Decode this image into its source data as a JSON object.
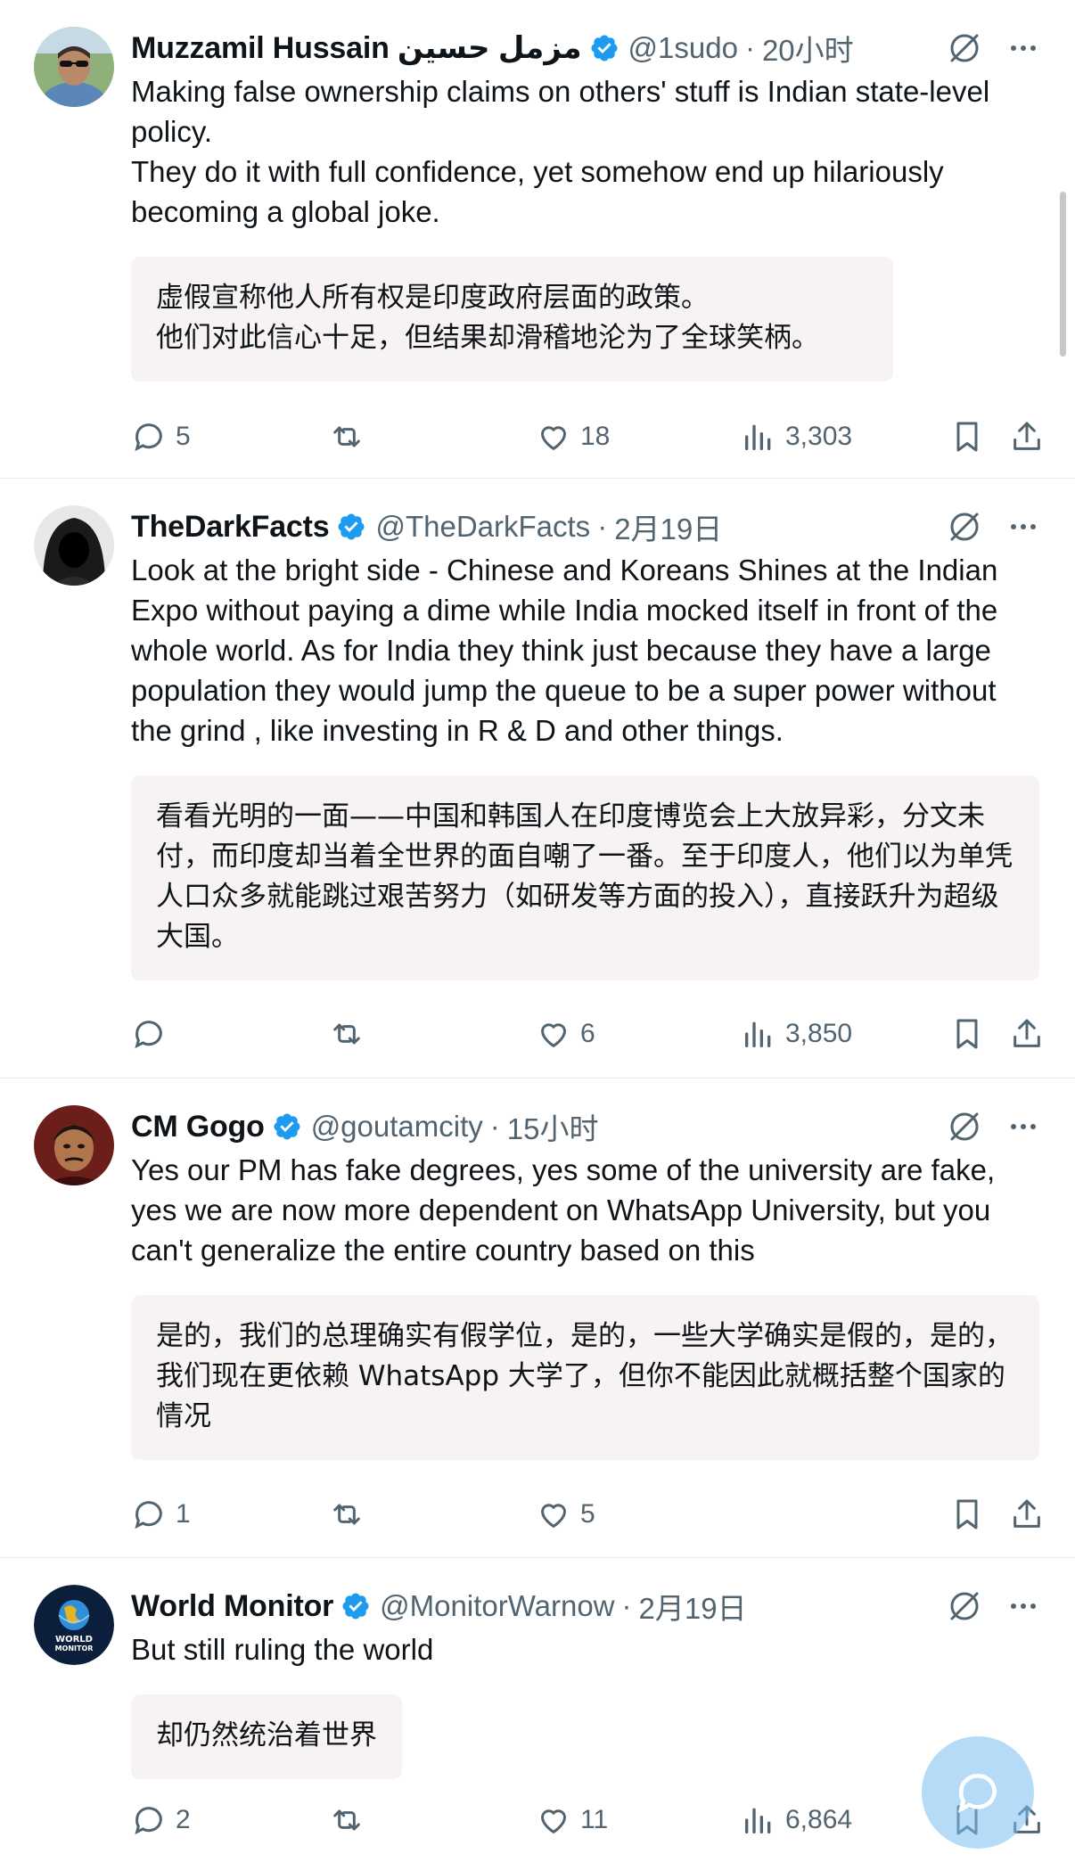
{
  "tweets": [
    {
      "name": "Muzzamil Hussain مزمل حسين",
      "handle": "@1sudo",
      "dot": "·",
      "time": "20小时",
      "text_lines": [
        "Making false ownership claims on others' stuff is Indian state-level policy.",
        "They do it with full confidence, yet somehow end up hilariously becoming a global joke."
      ],
      "translation_lines": [
        "虚假宣称他人所有权是印度政府层面的政策。",
        "他们对此信心十足，但结果却滑稽地沦为了全球笑柄。"
      ],
      "replies": "5",
      "retweets": "",
      "likes": "18",
      "views": "3,303",
      "avatar": "portrait-sunglasses"
    },
    {
      "name": "TheDarkFacts",
      "handle": "@TheDarkFacts",
      "dot": "·",
      "time": "2月19日",
      "text_lines": [
        "Look at the bright side - Chinese and Koreans Shines at the Indian Expo without paying a dime while India mocked itself in front of the whole world. As for India they think just because they have a large population they would jump the queue to be a super power without the grind , like investing in R & D and other things."
      ],
      "translation_lines": [
        "看看光明的一面——中国和韩国人在印度博览会上大放异彩，分文未付，而印度却当着全世界的面自嘲了一番。至于印度人，他们以为单凭人口众多就能跳过艰苦努力（如研发等方面的投入），直接跃升为超级大国。"
      ],
      "replies": "",
      "retweets": "",
      "likes": "6",
      "views": "3,850",
      "avatar": "hooded-figure"
    },
    {
      "name": "CM Gogo",
      "handle": "@goutamcity",
      "dot": "·",
      "time": "15小时",
      "text_lines": [
        "Yes our PM has fake degrees, yes some of the university are fake, yes we are now more dependent on WhatsApp University, but you can't generalize the entire country based on this"
      ],
      "translation_lines": [
        "是的，我们的总理确实有假学位，是的，一些大学确实是假的，是的，我们现在更依赖 WhatsApp 大学了，但你不能因此就概括整个国家的情况"
      ],
      "replies": "1",
      "retweets": "",
      "likes": "5",
      "views": "",
      "avatar": "portrait-red"
    },
    {
      "name": "World Monitor",
      "handle": "@MonitorWarnow",
      "dot": "·",
      "time": "2月19日",
      "text_lines": [
        "But still ruling the world"
      ],
      "translation_lines": [
        "却仍然统治着世界"
      ],
      "replies": "2",
      "retweets": "",
      "likes": "11",
      "views": "6,864",
      "avatar": "globe-logo",
      "avatar_text": [
        "WORLD",
        "MONITOR"
      ]
    }
  ],
  "icons": {
    "verified": "verified-badge-icon",
    "grok": "grok-icon",
    "more": "more-icon",
    "reply": "reply-icon",
    "retweet": "retweet-icon",
    "like": "heart-icon",
    "views": "views-icon",
    "bookmark": "bookmark-icon",
    "share": "share-icon",
    "fab": "compose-reply-icon"
  },
  "colors": {
    "accent": "#1d9bf0",
    "text": "#0f1419",
    "muted": "#536471",
    "translation_bg": "#f7f3f3"
  }
}
